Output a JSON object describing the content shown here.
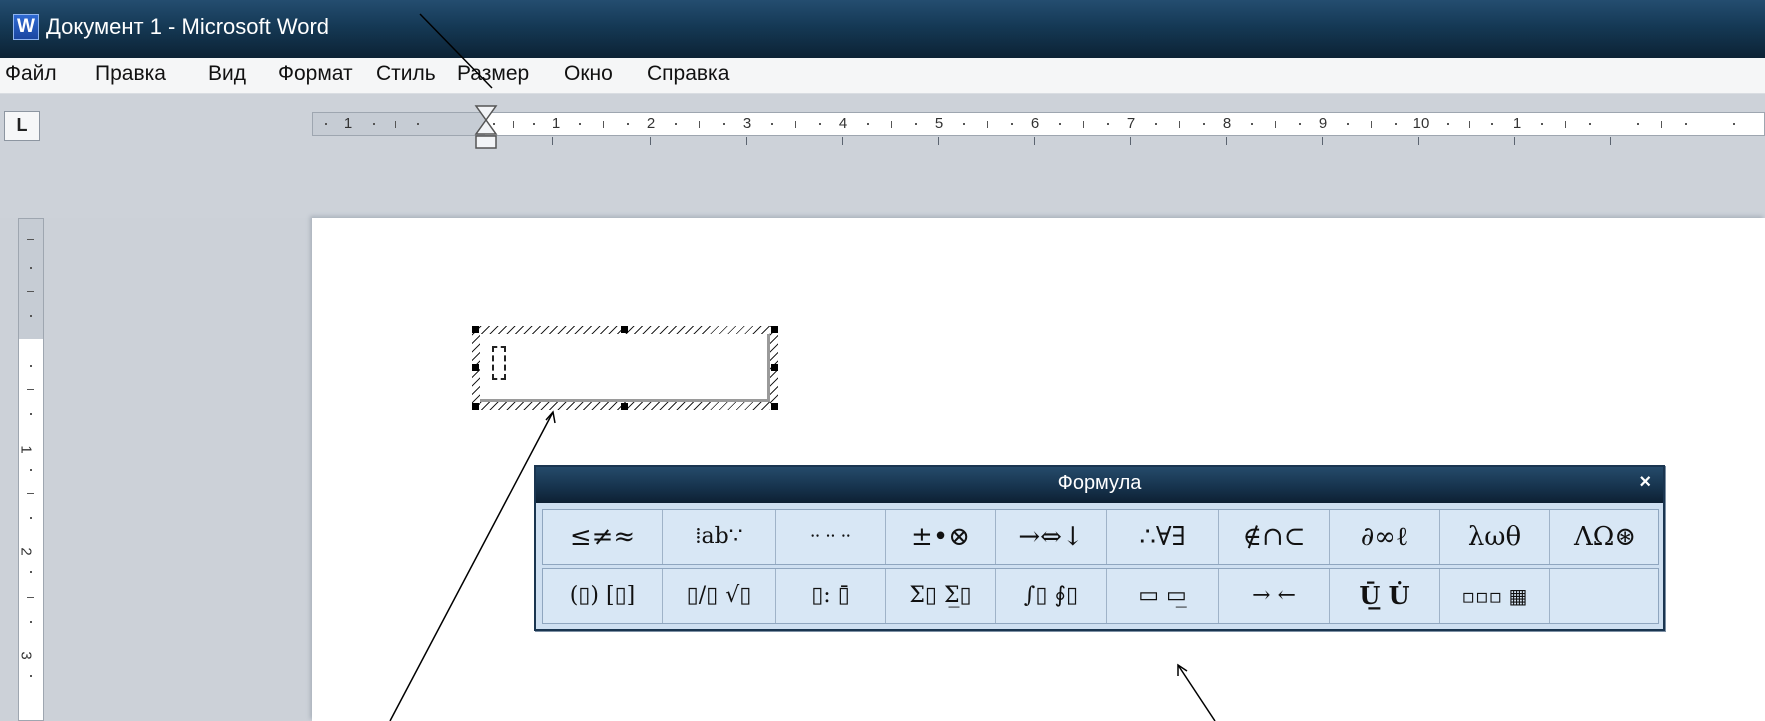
{
  "window": {
    "title": "Документ 1 - Microsoft Word",
    "app_icon_letter": "W"
  },
  "menu": {
    "items": [
      "Файл",
      "Правка",
      "Вид",
      "Формат",
      "Стиль",
      "Размер",
      "Окно",
      "Справка"
    ]
  },
  "ruler": {
    "tab_stop_symbol": "L",
    "horizontal_labels": [
      "1",
      "1",
      "2",
      "3",
      "4",
      "5",
      "6",
      "7",
      "8",
      "9",
      "10",
      "1"
    ],
    "vertical_labels": [
      "1",
      "2",
      "3"
    ]
  },
  "formula_toolbar": {
    "title": "Формула",
    "close_symbol": "×",
    "row1": [
      "≤≠≈",
      "⁞ab∵",
      "⸱⸱ ⸱⸱ ⸱⸱",
      "±•⊗",
      "→⇔↓",
      "∴∀∃",
      "∉∩⊂",
      "∂∞ℓ",
      "λωθ",
      "ΛΩ⊛"
    ],
    "row2": [
      "(▯) [▯]",
      "▯/▯ √▯",
      "▯: ▯̄",
      "Σ▯ Σ̲▯",
      "∫▯ ∮▯",
      "▭ ▭̲",
      "→ ←",
      "Ū̲ U̇",
      "▫▫▫ ▦",
      ""
    ]
  },
  "colors": {
    "titlebar": "#153955",
    "toolbar_bg": "#cfe0f1",
    "workspace": "#ccd1d8"
  }
}
